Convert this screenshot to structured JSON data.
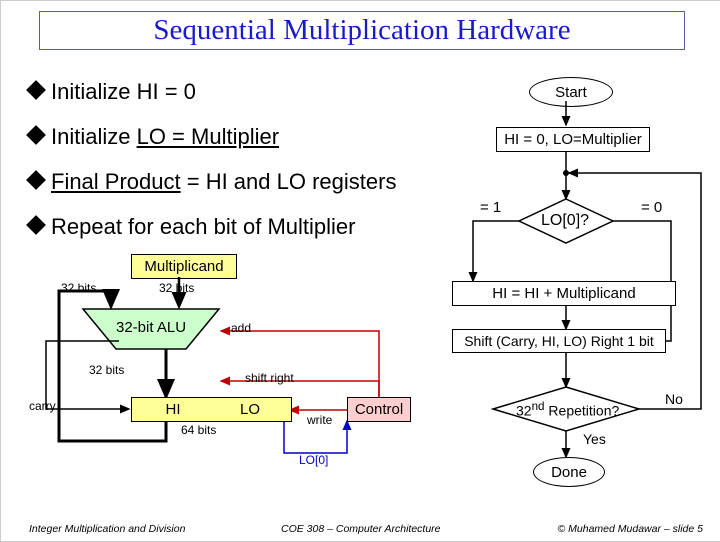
{
  "title": "Sequential Multiplication Hardware",
  "bullets": [
    "Initialize HI = 0",
    "Initialize LO = Multiplier",
    "Final Product = HI and LO registers",
    "Repeat for each bit of Multiplier"
  ],
  "flow": {
    "start": "Start",
    "init": "HI = 0, LO=Multiplier",
    "test": "LO[0]?",
    "test_yes": "= 1",
    "test_no": "= 0",
    "add": "HI = HI + Multiplicand",
    "shift": "Shift (Carry, HI, LO) Right 1 bit",
    "rep": "32ⁿᵈ Repetition?",
    "rep_yes": "Yes",
    "rep_no": "No",
    "done": "Done"
  },
  "hw": {
    "multiplicand": "Multiplicand",
    "alu": "32-bit ALU",
    "hi": "HI",
    "lo": "LO",
    "control": "Control",
    "add_lbl": "add",
    "shift_right": "shift right",
    "write_lbl": "write",
    "carry": "carry",
    "bits32": "32 bits",
    "bits64": "64 bits",
    "lo0": "LO[0]"
  },
  "footer": {
    "left": "Integer Multiplication and Division",
    "mid": "COE 308 – Computer Architecture",
    "right": "© Muhamed Mudawar – slide 5"
  }
}
